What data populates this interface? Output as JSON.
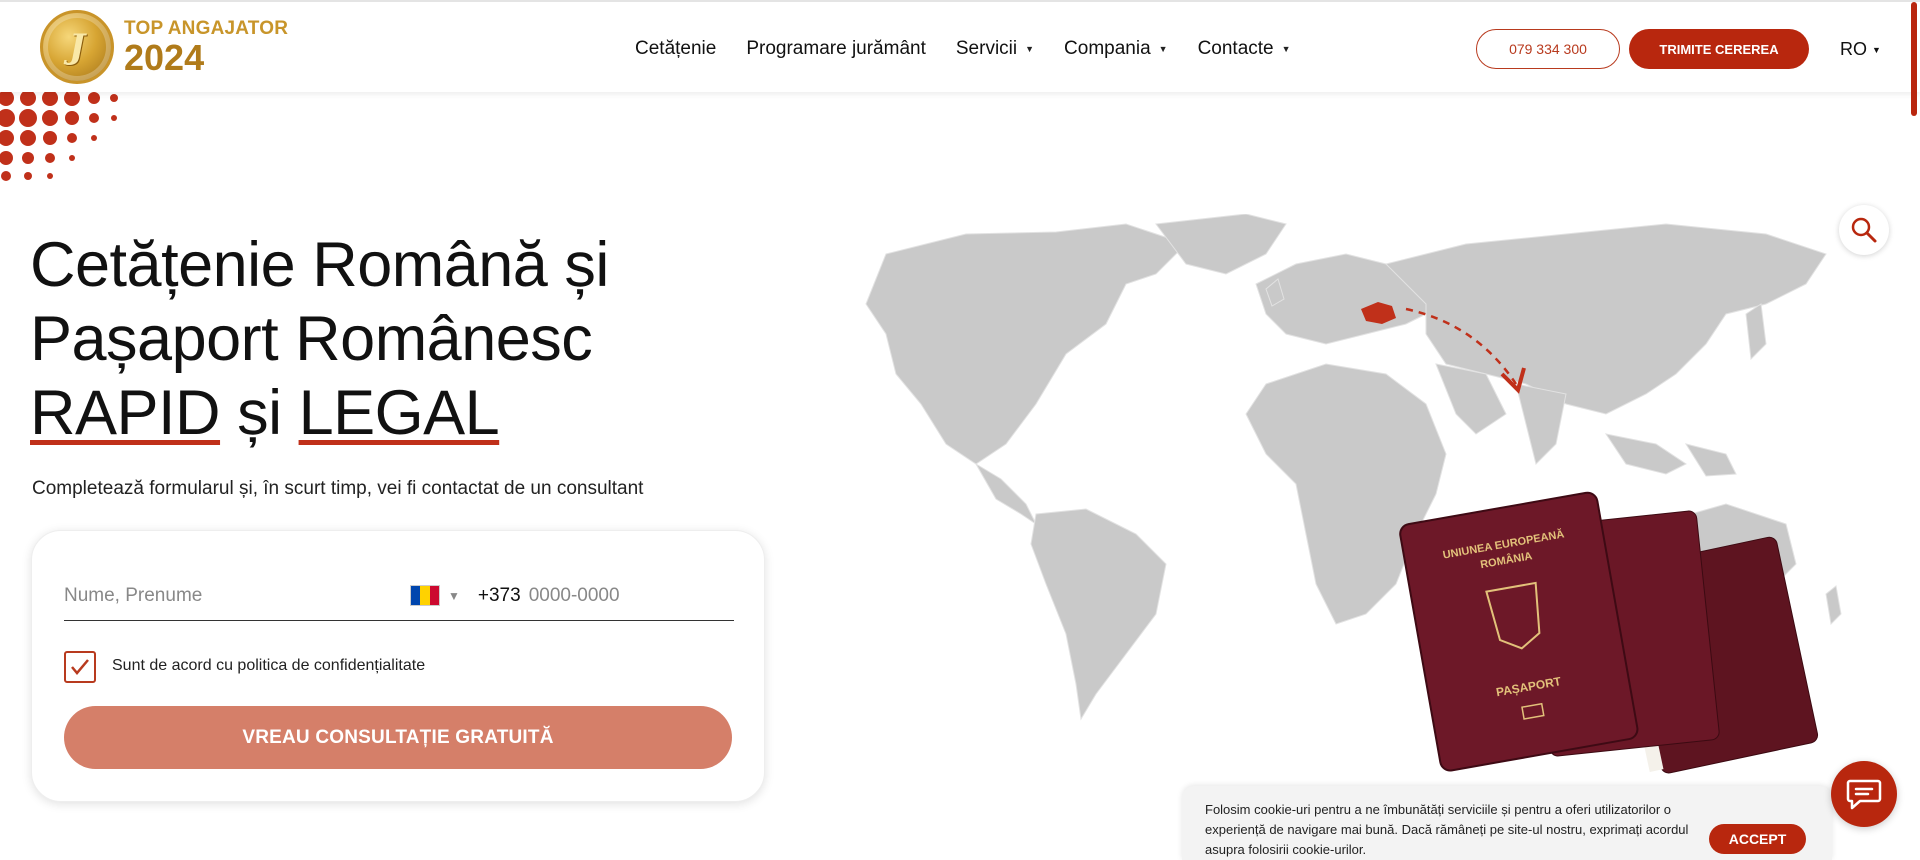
{
  "brand": {
    "logo_glyph": "J",
    "badge_top": "TOP ANGAJATOR",
    "badge_year": "2024",
    "colors": {
      "accent": "#b8270e",
      "gold": "#c8952a",
      "button_muted": "#d57f69"
    }
  },
  "nav": {
    "items": [
      {
        "label": "Cetățenie",
        "has_dropdown": false
      },
      {
        "label": "Programare jurământ",
        "has_dropdown": false
      },
      {
        "label": "Servicii",
        "has_dropdown": true
      },
      {
        "label": "Compania",
        "has_dropdown": true
      },
      {
        "label": "Contacte",
        "has_dropdown": true
      }
    ],
    "phone": "079 334 300",
    "cta": "TRIMITE CEREREA",
    "language": "RO"
  },
  "hero": {
    "title_line1": "Cetățenie Română și",
    "title_line2": "Pașaport Românesc",
    "title_word1": "RAPID",
    "title_and": "și",
    "title_word2": "LEGAL",
    "subtitle": "Completează formularul și, în scurt timp, vei fi contactat de un consultant"
  },
  "form": {
    "name_placeholder": "Nume, Prenume",
    "phone_prefix": "+373",
    "phone_placeholder": "0000-0000",
    "consent_label": "Sunt de acord cu politica de confidențialitate",
    "consent_checked": true,
    "submit_label": "VREAU CONSULTAȚIE GRATUITĂ"
  },
  "passport": {
    "cover_line1": "UNIUNEA EUROPEANĂ",
    "cover_line2": "ROMÂNIA",
    "cover_label": "PAȘAPORT"
  },
  "cookie": {
    "text": "Folosim cookie-uri pentru a ne îmbunătăți serviciile și pentru a oferi utilizatorilor o experiență de navigare mai bună. Dacă rămâneți pe site-ul nostru, exprimați acordul asupra folosirii cookie-urilor.",
    "accept_label": "ACCEPT"
  },
  "icons": {
    "search": "search-icon",
    "chat": "chat-icon",
    "check": "check-icon",
    "caret": "chevron-down-icon"
  }
}
